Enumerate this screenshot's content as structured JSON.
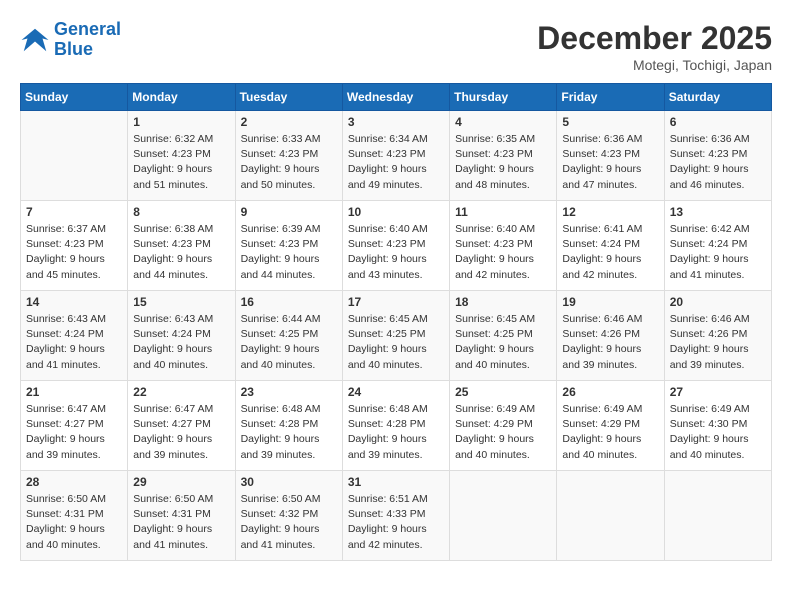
{
  "logo": {
    "line1": "General",
    "line2": "Blue"
  },
  "title": "December 2025",
  "location": "Motegi, Tochigi, Japan",
  "weekdays": [
    "Sunday",
    "Monday",
    "Tuesday",
    "Wednesday",
    "Thursday",
    "Friday",
    "Saturday"
  ],
  "weeks": [
    [
      {
        "day": "",
        "info": ""
      },
      {
        "day": "1",
        "info": "Sunrise: 6:32 AM\nSunset: 4:23 PM\nDaylight: 9 hours\nand 51 minutes."
      },
      {
        "day": "2",
        "info": "Sunrise: 6:33 AM\nSunset: 4:23 PM\nDaylight: 9 hours\nand 50 minutes."
      },
      {
        "day": "3",
        "info": "Sunrise: 6:34 AM\nSunset: 4:23 PM\nDaylight: 9 hours\nand 49 minutes."
      },
      {
        "day": "4",
        "info": "Sunrise: 6:35 AM\nSunset: 4:23 PM\nDaylight: 9 hours\nand 48 minutes."
      },
      {
        "day": "5",
        "info": "Sunrise: 6:36 AM\nSunset: 4:23 PM\nDaylight: 9 hours\nand 47 minutes."
      },
      {
        "day": "6",
        "info": "Sunrise: 6:36 AM\nSunset: 4:23 PM\nDaylight: 9 hours\nand 46 minutes."
      }
    ],
    [
      {
        "day": "7",
        "info": "Sunrise: 6:37 AM\nSunset: 4:23 PM\nDaylight: 9 hours\nand 45 minutes."
      },
      {
        "day": "8",
        "info": "Sunrise: 6:38 AM\nSunset: 4:23 PM\nDaylight: 9 hours\nand 44 minutes."
      },
      {
        "day": "9",
        "info": "Sunrise: 6:39 AM\nSunset: 4:23 PM\nDaylight: 9 hours\nand 44 minutes."
      },
      {
        "day": "10",
        "info": "Sunrise: 6:40 AM\nSunset: 4:23 PM\nDaylight: 9 hours\nand 43 minutes."
      },
      {
        "day": "11",
        "info": "Sunrise: 6:40 AM\nSunset: 4:23 PM\nDaylight: 9 hours\nand 42 minutes."
      },
      {
        "day": "12",
        "info": "Sunrise: 6:41 AM\nSunset: 4:24 PM\nDaylight: 9 hours\nand 42 minutes."
      },
      {
        "day": "13",
        "info": "Sunrise: 6:42 AM\nSunset: 4:24 PM\nDaylight: 9 hours\nand 41 minutes."
      }
    ],
    [
      {
        "day": "14",
        "info": "Sunrise: 6:43 AM\nSunset: 4:24 PM\nDaylight: 9 hours\nand 41 minutes."
      },
      {
        "day": "15",
        "info": "Sunrise: 6:43 AM\nSunset: 4:24 PM\nDaylight: 9 hours\nand 40 minutes."
      },
      {
        "day": "16",
        "info": "Sunrise: 6:44 AM\nSunset: 4:25 PM\nDaylight: 9 hours\nand 40 minutes."
      },
      {
        "day": "17",
        "info": "Sunrise: 6:45 AM\nSunset: 4:25 PM\nDaylight: 9 hours\nand 40 minutes."
      },
      {
        "day": "18",
        "info": "Sunrise: 6:45 AM\nSunset: 4:25 PM\nDaylight: 9 hours\nand 40 minutes."
      },
      {
        "day": "19",
        "info": "Sunrise: 6:46 AM\nSunset: 4:26 PM\nDaylight: 9 hours\nand 39 minutes."
      },
      {
        "day": "20",
        "info": "Sunrise: 6:46 AM\nSunset: 4:26 PM\nDaylight: 9 hours\nand 39 minutes."
      }
    ],
    [
      {
        "day": "21",
        "info": "Sunrise: 6:47 AM\nSunset: 4:27 PM\nDaylight: 9 hours\nand 39 minutes."
      },
      {
        "day": "22",
        "info": "Sunrise: 6:47 AM\nSunset: 4:27 PM\nDaylight: 9 hours\nand 39 minutes."
      },
      {
        "day": "23",
        "info": "Sunrise: 6:48 AM\nSunset: 4:28 PM\nDaylight: 9 hours\nand 39 minutes."
      },
      {
        "day": "24",
        "info": "Sunrise: 6:48 AM\nSunset: 4:28 PM\nDaylight: 9 hours\nand 39 minutes."
      },
      {
        "day": "25",
        "info": "Sunrise: 6:49 AM\nSunset: 4:29 PM\nDaylight: 9 hours\nand 40 minutes."
      },
      {
        "day": "26",
        "info": "Sunrise: 6:49 AM\nSunset: 4:29 PM\nDaylight: 9 hours\nand 40 minutes."
      },
      {
        "day": "27",
        "info": "Sunrise: 6:49 AM\nSunset: 4:30 PM\nDaylight: 9 hours\nand 40 minutes."
      }
    ],
    [
      {
        "day": "28",
        "info": "Sunrise: 6:50 AM\nSunset: 4:31 PM\nDaylight: 9 hours\nand 40 minutes."
      },
      {
        "day": "29",
        "info": "Sunrise: 6:50 AM\nSunset: 4:31 PM\nDaylight: 9 hours\nand 41 minutes."
      },
      {
        "day": "30",
        "info": "Sunrise: 6:50 AM\nSunset: 4:32 PM\nDaylight: 9 hours\nand 41 minutes."
      },
      {
        "day": "31",
        "info": "Sunrise: 6:51 AM\nSunset: 4:33 PM\nDaylight: 9 hours\nand 42 minutes."
      },
      {
        "day": "",
        "info": ""
      },
      {
        "day": "",
        "info": ""
      },
      {
        "day": "",
        "info": ""
      }
    ]
  ]
}
